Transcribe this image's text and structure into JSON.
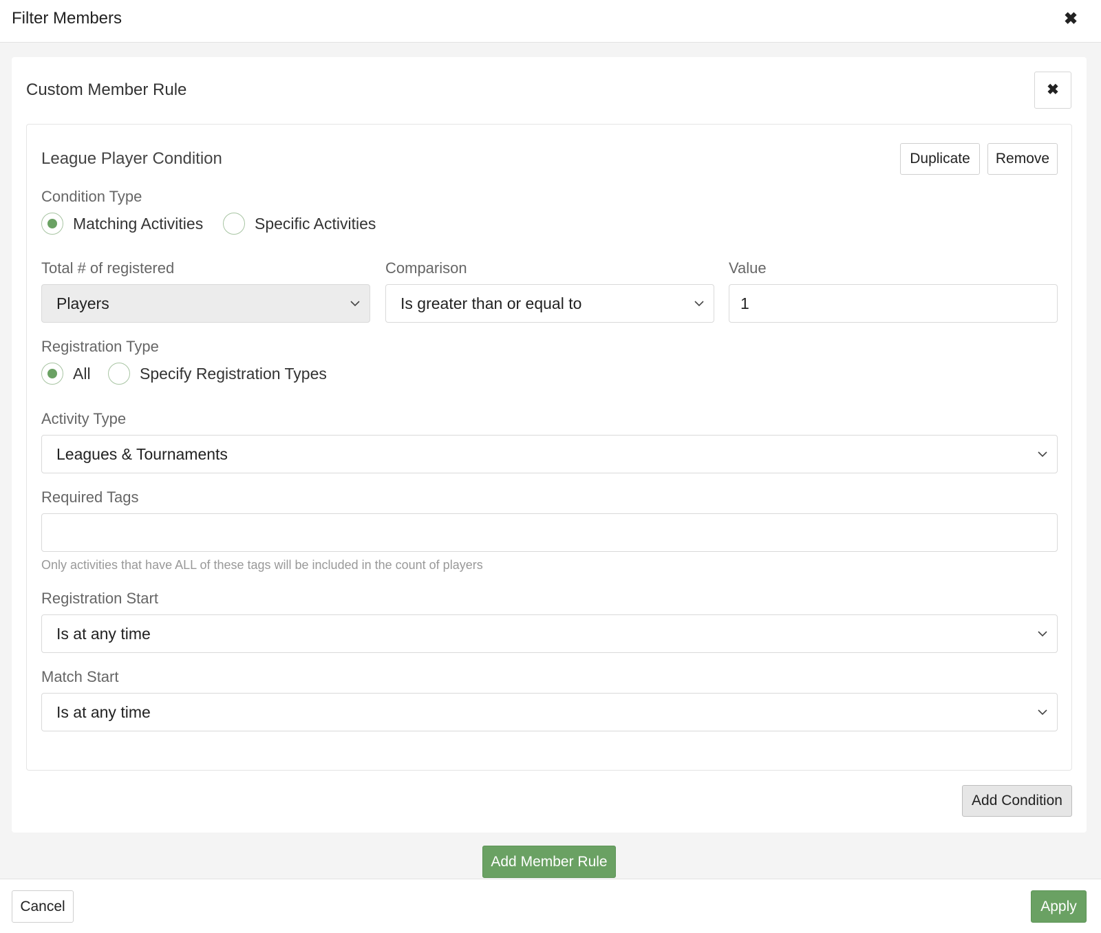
{
  "header": {
    "title": "Filter Members",
    "close_icon": "✖"
  },
  "rule": {
    "title": "Custom Member Rule",
    "close_icon": "✖",
    "condition": {
      "title": "League Player Condition",
      "duplicate_label": "Duplicate",
      "remove_label": "Remove",
      "condition_type": {
        "label": "Condition Type",
        "options": [
          "Matching Activities",
          "Specific Activities"
        ],
        "selected": "Matching Activities"
      },
      "total_registered": {
        "label": "Total # of registered",
        "value": "Players"
      },
      "comparison": {
        "label": "Comparison",
        "value": "Is greater than or equal to"
      },
      "value_field": {
        "label": "Value",
        "value": "1"
      },
      "registration_type": {
        "label": "Registration Type",
        "options": [
          "All",
          "Specify Registration Types"
        ],
        "selected": "All"
      },
      "activity_type": {
        "label": "Activity Type",
        "value": "Leagues & Tournaments"
      },
      "required_tags": {
        "label": "Required Tags",
        "value": "",
        "help": "Only activities that have ALL of these tags will be included in the count of players"
      },
      "registration_start": {
        "label": "Registration Start",
        "value": "Is at any time"
      },
      "match_start": {
        "label": "Match Start",
        "value": "Is at any time"
      }
    },
    "add_condition_label": "Add Condition"
  },
  "add_member_rule_label": "Add Member Rule",
  "footer": {
    "cancel_label": "Cancel",
    "apply_label": "Apply"
  },
  "colors": {
    "accent": "#6aa163",
    "radio_border": "#a7c4a2",
    "background": "#f4f4f4"
  }
}
